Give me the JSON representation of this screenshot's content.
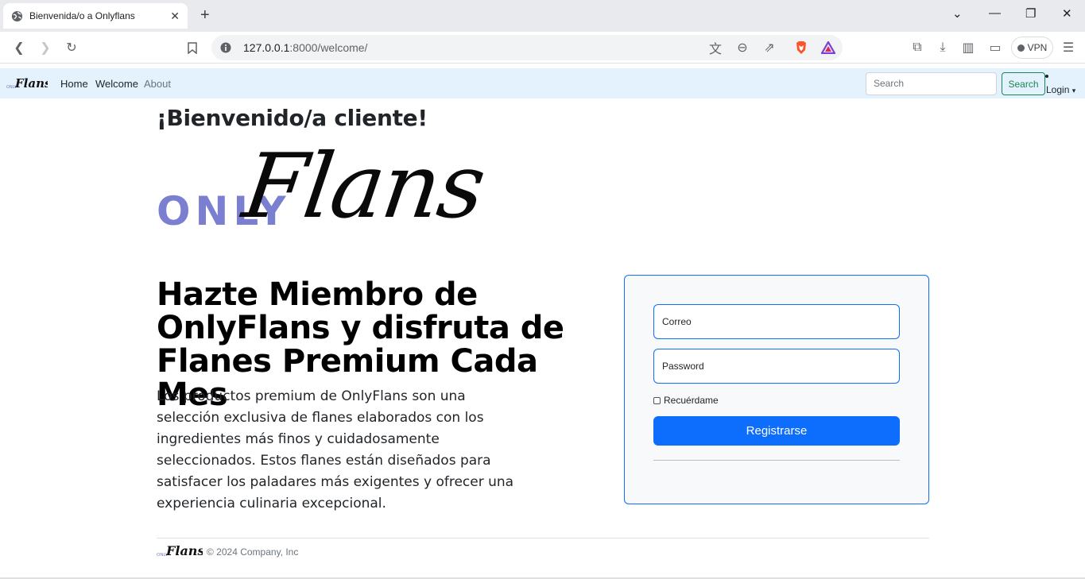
{
  "browser": {
    "tab_title": "Bienvenida/o a Onlyflans",
    "url_host": "127.0.0.1",
    "url_rest": ":8000/welcome/",
    "vpn_label": "VPN"
  },
  "navbar": {
    "logo_only": "ONLY",
    "logo_flans": "Flans",
    "links": [
      "Home",
      "Welcome",
      "About"
    ],
    "search_placeholder": "Search",
    "search_button": "Search",
    "login_label": "Login"
  },
  "main": {
    "welcome": "¡Bienvenido/a cliente!",
    "logo_only": "ONLY",
    "logo_flans": "Flans",
    "headline": "Hazte Miembro de OnlyFlans y disfruta de Flanes Premium Cada Mes",
    "lead": "Los productos premium de OnlyFlans son una selección exclusiva de flanes elaborados con los ingredientes más finos y cuidadosamente seleccionados. Estos flanes están diseñados para satisfacer los paladares más exigentes y ofrecer una experiencia culinaria excepcional."
  },
  "form": {
    "email_placeholder": "Correo",
    "password_placeholder": "Password",
    "remember_label": "Recuérdame",
    "submit_label": "Registrarse"
  },
  "footer": {
    "logo_only": "ONLY",
    "logo_flans": "Flans",
    "copyright": "© 2024 Company, Inc"
  },
  "colors": {
    "navbar_bg": "#e3f2fd",
    "primary": "#0d6efd",
    "success": "#198754",
    "logo_only": "#7b7fcf"
  }
}
